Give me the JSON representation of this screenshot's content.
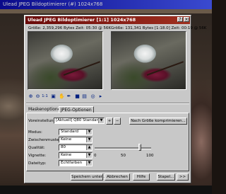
{
  "background_window": {
    "title": "Ulead JPEG Bildoptimierer (#) 1024x768"
  },
  "dialog": {
    "title": "Ulead JPEG Bildoptimierer [1:1] 1024x768",
    "left_info": "Größe: 2,359,296 Bytes Zeit: 05:30 @ 56K",
    "right_info": "Größe: 131,341 Bytes [1:18.0] Zeit: 00:19 @ 56K",
    "tabs": [
      "Maskenoptionen",
      "JPEG-Optionen"
    ],
    "active_tab": "JPEG-Optionen",
    "preset_label": "Voreinstellung:",
    "preset_value": "[Aktuell] Q80 Standard",
    "compress_button": "Nach Größe komprimieren...",
    "mode_label": "Modus:",
    "mode_value": "Standard",
    "subsampling_label": "Zwischenmuster:",
    "subsampling_value": "Keine",
    "quality_label": "Qualität:",
    "quality_value": "80",
    "smoothing_label": "Vignette:",
    "smoothing_value": "Keine",
    "datatype_label": "Dateityp:",
    "datatype_value": "Echtfarben",
    "slider_ticks": [
      "0",
      "50",
      "100"
    ],
    "quality_level": 0.8,
    "buttons": {
      "save": "Speichern unter...",
      "cancel": "Abbrechen",
      "help": "Hilfe",
      "batch": "Stapel..."
    }
  },
  "toolbar_icons": [
    "zoom-icon",
    "zoom-out-icon",
    "actual-size-icon",
    "fit-icon",
    "hand-icon",
    "eyedropper-icon",
    "color-icon",
    "layout-icon",
    "globe-icon",
    "arrow-icon"
  ]
}
